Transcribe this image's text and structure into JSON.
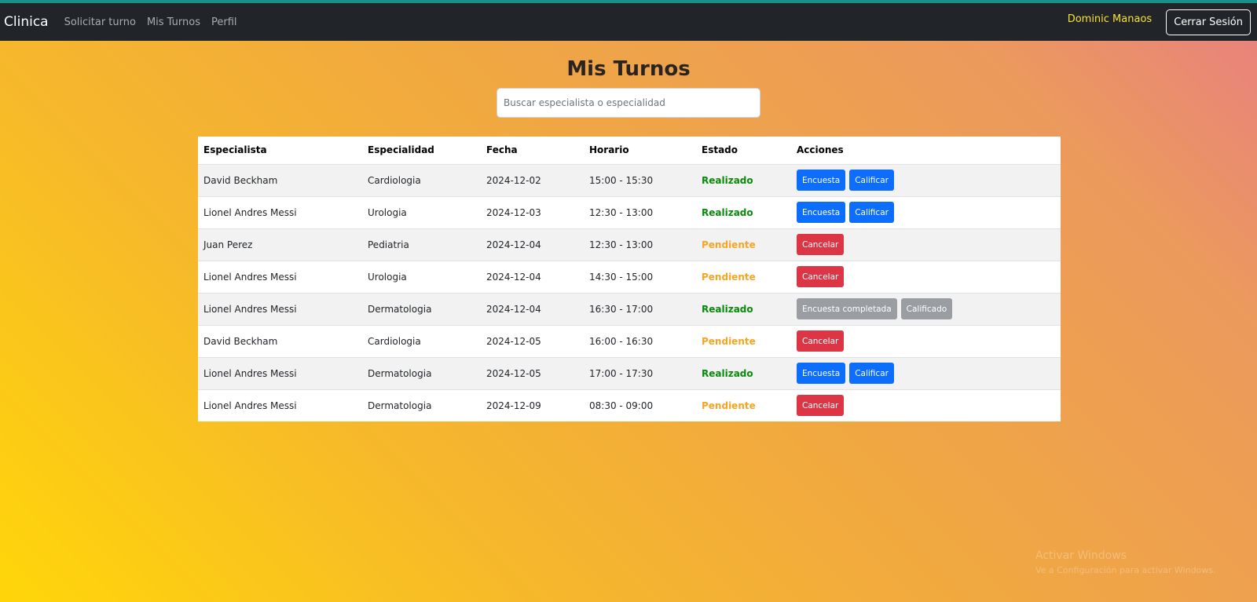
{
  "nav": {
    "brand": "Clinica",
    "links": [
      "Solicitar turno",
      "Mis Turnos",
      "Perfil"
    ],
    "user_name": "Dominic Manaos",
    "logout_label": "Cerrar Sesión"
  },
  "page": {
    "title": "Mis Turnos",
    "search_placeholder": "Buscar especialista o especialidad"
  },
  "table": {
    "headers": [
      "Especialista",
      "Especialidad",
      "Fecha",
      "Horario",
      "Estado",
      "Acciones"
    ],
    "rows": [
      {
        "especialista": "David Beckham",
        "especialidad": "Cardiologia",
        "fecha": "2024-12-02",
        "horario": "15:00 - 15:30",
        "estado": "Realizado",
        "actions": [
          "Encuesta",
          "Calificar"
        ]
      },
      {
        "especialista": "Lionel Andres Messi",
        "especialidad": "Urologia",
        "fecha": "2024-12-03",
        "horario": "12:30 - 13:00",
        "estado": "Realizado",
        "actions": [
          "Encuesta",
          "Calificar"
        ]
      },
      {
        "especialista": "Juan Perez",
        "especialidad": "Pediatria",
        "fecha": "2024-12-04",
        "horario": "12:30 - 13:00",
        "estado": "Pendiente",
        "actions": [
          "Cancelar"
        ]
      },
      {
        "especialista": "Lionel Andres Messi",
        "especialidad": "Urologia",
        "fecha": "2024-12-04",
        "horario": "14:30 - 15:00",
        "estado": "Pendiente",
        "actions": [
          "Cancelar"
        ]
      },
      {
        "especialista": "Lionel Andres Messi",
        "especialidad": "Dermatologia",
        "fecha": "2024-12-04",
        "horario": "16:30 - 17:00",
        "estado": "Realizado",
        "actions": [
          "Encuesta completada",
          "Calificado"
        ]
      },
      {
        "especialista": "David Beckham",
        "especialidad": "Cardiologia",
        "fecha": "2024-12-05",
        "horario": "16:00 - 16:30",
        "estado": "Pendiente",
        "actions": [
          "Cancelar"
        ]
      },
      {
        "especialista": "Lionel Andres Messi",
        "especialidad": "Dermatologia",
        "fecha": "2024-12-05",
        "horario": "17:00 - 17:30",
        "estado": "Realizado",
        "actions": [
          "Encuesta",
          "Calificar"
        ]
      },
      {
        "especialista": "Lionel Andres Messi",
        "especialidad": "Dermatologia",
        "fecha": "2024-12-09",
        "horario": "08:30 - 09:00",
        "estado": "Pendiente",
        "actions": [
          "Cancelar"
        ]
      }
    ]
  },
  "watermark": {
    "line1": "Activar Windows",
    "line2": "Ve a Configuración para activar Windows."
  },
  "colors": {
    "navbar": "#212529",
    "realizado": "#0a8a0a",
    "pendiente": "#f5a524",
    "primary": "#0d6efd",
    "danger": "#dc3545",
    "secondary": "#9a9da2",
    "user_name": "#f7e335"
  }
}
